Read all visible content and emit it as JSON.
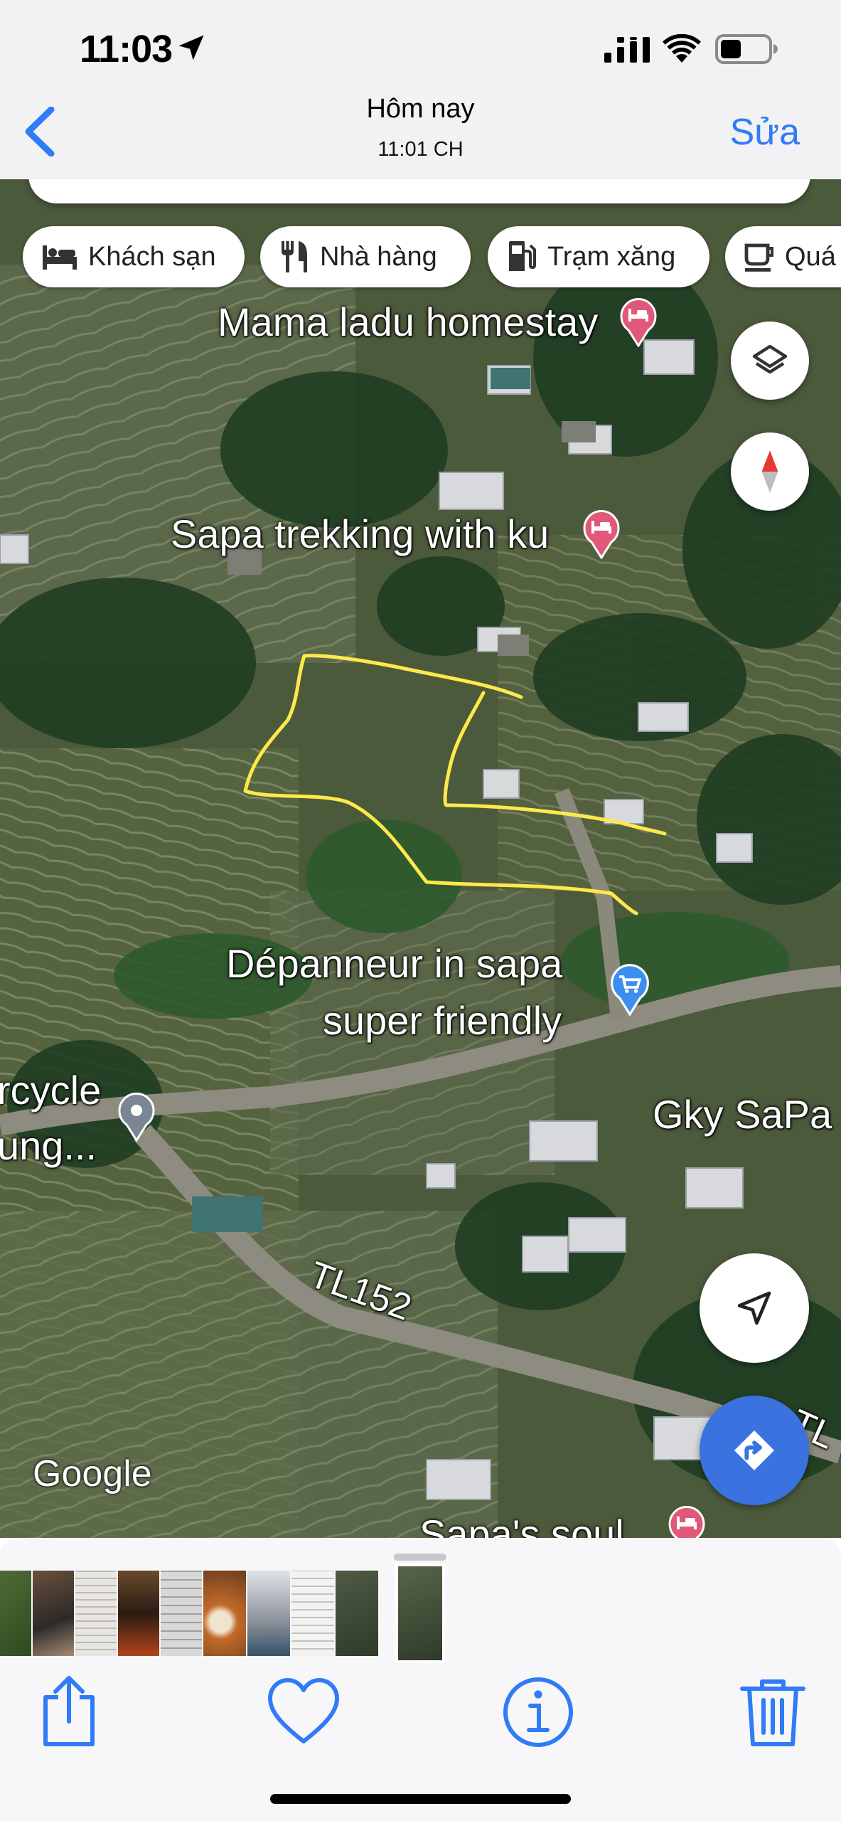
{
  "status_bar": {
    "time": "11:03"
  },
  "nav": {
    "title": "Hôm nay",
    "subtitle": "11:01 CH",
    "edit_label": "Sửa"
  },
  "map": {
    "chips": [
      "Khách sạn",
      "Nhà hàng",
      "Trạm xăng",
      "Quá"
    ],
    "places": {
      "mama": "Mama ladu homestay",
      "trekking": "Sapa trekking with ku",
      "depanneur_line1": "Dépanneur in sapa",
      "depanneur_line2": "super friendly",
      "motorcycle_line1": "rcycle",
      "motorcycle_line2": "ung...",
      "gky": "Gky SaPa",
      "road": "TL152",
      "road_right": "TL",
      "soul": "Sapa's soul"
    },
    "logo": "Google"
  },
  "icons": {
    "location": "location-arrow-icon",
    "back": "chevron-left-icon",
    "layers": "layers-icon",
    "compass": "compass-icon",
    "my_location": "navigation-arrow-icon",
    "directions": "directions-icon",
    "share": "share-icon",
    "favorite": "heart-icon",
    "info": "info-icon",
    "delete": "trash-icon"
  },
  "colors": {
    "accent": "#2f7cf6",
    "drawing": "#ffe94a",
    "pin_hotel": "#e0587a",
    "pin_shop": "#3c8ef0",
    "directions_fab": "#3a73e0"
  }
}
